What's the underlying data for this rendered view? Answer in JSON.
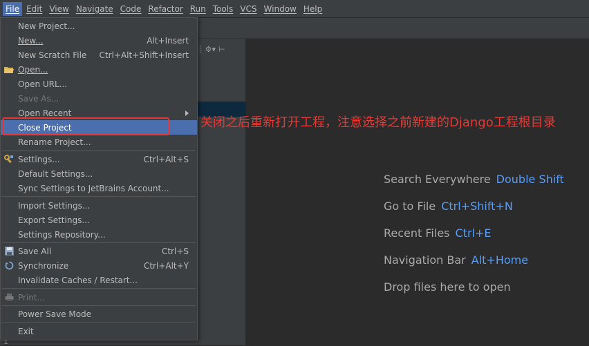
{
  "menubar": {
    "items": [
      "File",
      "Edit",
      "View",
      "Navigate",
      "Code",
      "Refactor",
      "Run",
      "Tools",
      "VCS",
      "Window",
      "Help"
    ]
  },
  "file_menu": {
    "new_project": "New Project...",
    "new": "New...",
    "new_shortcut": "Alt+Insert",
    "new_scratch_file": "New Scratch File",
    "new_scratch_file_shortcut": "Ctrl+Alt+Shift+Insert",
    "open": "Open...",
    "open_url": "Open URL...",
    "save_as": "Save As...",
    "open_recent": "Open Recent",
    "close_project": "Close Project",
    "rename_project": "Rename Project...",
    "settings": "Settings...",
    "settings_shortcut": "Ctrl+Alt+S",
    "default_settings": "Default Settings...",
    "sync_settings": "Sync Settings to JetBrains Account...",
    "import_settings": "Import Settings...",
    "export_settings": "Export Settings...",
    "settings_repository": "Settings Repository...",
    "save_all": "Save All",
    "save_all_shortcut": "Ctrl+S",
    "synchronize": "Synchronize",
    "synchronize_shortcut": "Ctrl+Alt+Y",
    "invalidate_caches": "Invalidate Caches / Restart...",
    "print": "Print...",
    "power_save_mode": "Power Save Mode",
    "exit": "Exit"
  },
  "annotation": "关闭之后重新打开工程，注意选择之前新建的Django工程根目录",
  "editor_hints": [
    {
      "label": "Search Everywhere",
      "key": "Double Shift"
    },
    {
      "label": "Go to File",
      "key": "Ctrl+Shift+N"
    },
    {
      "label": "Recent Files",
      "key": "Ctrl+E"
    },
    {
      "label": "Navigation Bar",
      "key": "Alt+Home"
    },
    {
      "label": "Drop files here to open",
      "key": ""
    }
  ],
  "colors": {
    "accent": "#4b6eaf",
    "annotation": "#e53935",
    "shortcut_hint": "#589df6"
  }
}
